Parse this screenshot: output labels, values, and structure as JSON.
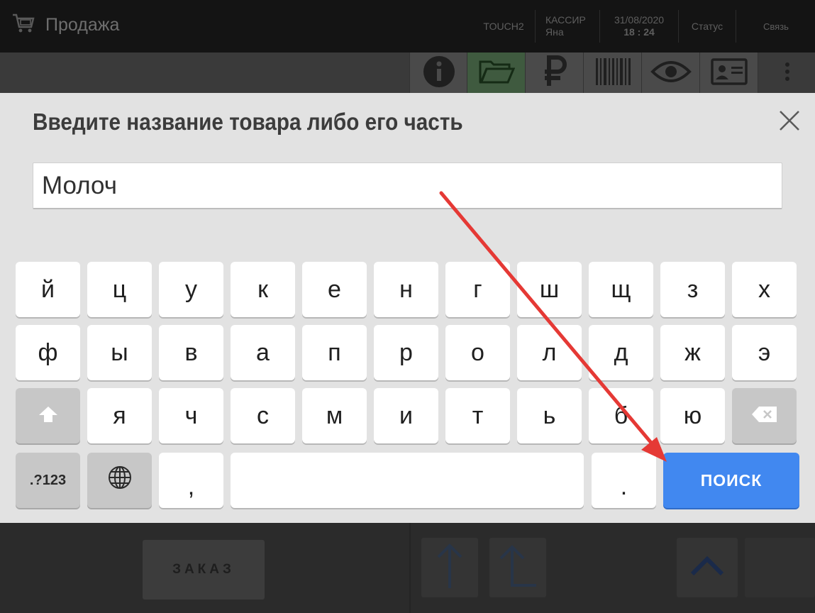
{
  "app": {
    "title": "Продажа",
    "terminal": "TOUCH2",
    "cashier_label": "КАССИР",
    "cashier_name": "Яна",
    "date": "31/08/2020",
    "time": "18 : 24",
    "status_label": "Статус",
    "connection_label": "Связь"
  },
  "toolbar": {
    "icons": [
      "info-icon",
      "folder-open-icon",
      "ruble-icon",
      "barcode-icon",
      "eye-icon",
      "id-card-icon",
      "more-vertical-icon"
    ]
  },
  "bottom": {
    "order_label": "ЗАКАЗ"
  },
  "dialog": {
    "title": "Введите название товара либо его часть",
    "input_value": "Молоч"
  },
  "keyboard": {
    "row1": [
      "й",
      "ц",
      "у",
      "к",
      "е",
      "н",
      "г",
      "ш",
      "щ",
      "з",
      "х"
    ],
    "row2": [
      "ф",
      "ы",
      "в",
      "а",
      "п",
      "р",
      "о",
      "л",
      "д",
      "ж",
      "э"
    ],
    "row3": [
      "я",
      "ч",
      "с",
      "м",
      "и",
      "т",
      "ь",
      "б",
      "ю"
    ],
    "symbols_label": ".?123",
    "comma": ",",
    "period": ".",
    "search_label": "ПОИСК"
  },
  "colors": {
    "search_key": "#4188f0",
    "annotation_arrow": "#e53935",
    "dialog_bg": "#e2e2e2"
  }
}
